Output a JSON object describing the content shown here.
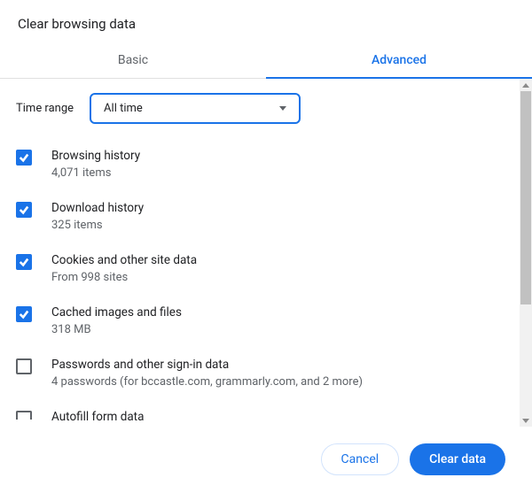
{
  "dialog": {
    "title": "Clear browsing data",
    "tabs": {
      "basic": "Basic",
      "advanced": "Advanced"
    },
    "time_range": {
      "label": "Time range",
      "selected": "All time"
    },
    "options": [
      {
        "label": "Browsing history",
        "sub": "4,071 items",
        "checked": true
      },
      {
        "label": "Download history",
        "sub": "325 items",
        "checked": true
      },
      {
        "label": "Cookies and other site data",
        "sub": "From 998 sites",
        "checked": true
      },
      {
        "label": "Cached images and files",
        "sub": "318 MB",
        "checked": true
      },
      {
        "label": "Passwords and other sign-in data",
        "sub": "4 passwords (for bccastle.com, grammarly.com, and 2 more)",
        "checked": false
      },
      {
        "label": "Autofill form data",
        "sub": "",
        "checked": false
      }
    ],
    "buttons": {
      "cancel": "Cancel",
      "clear": "Clear data"
    }
  }
}
